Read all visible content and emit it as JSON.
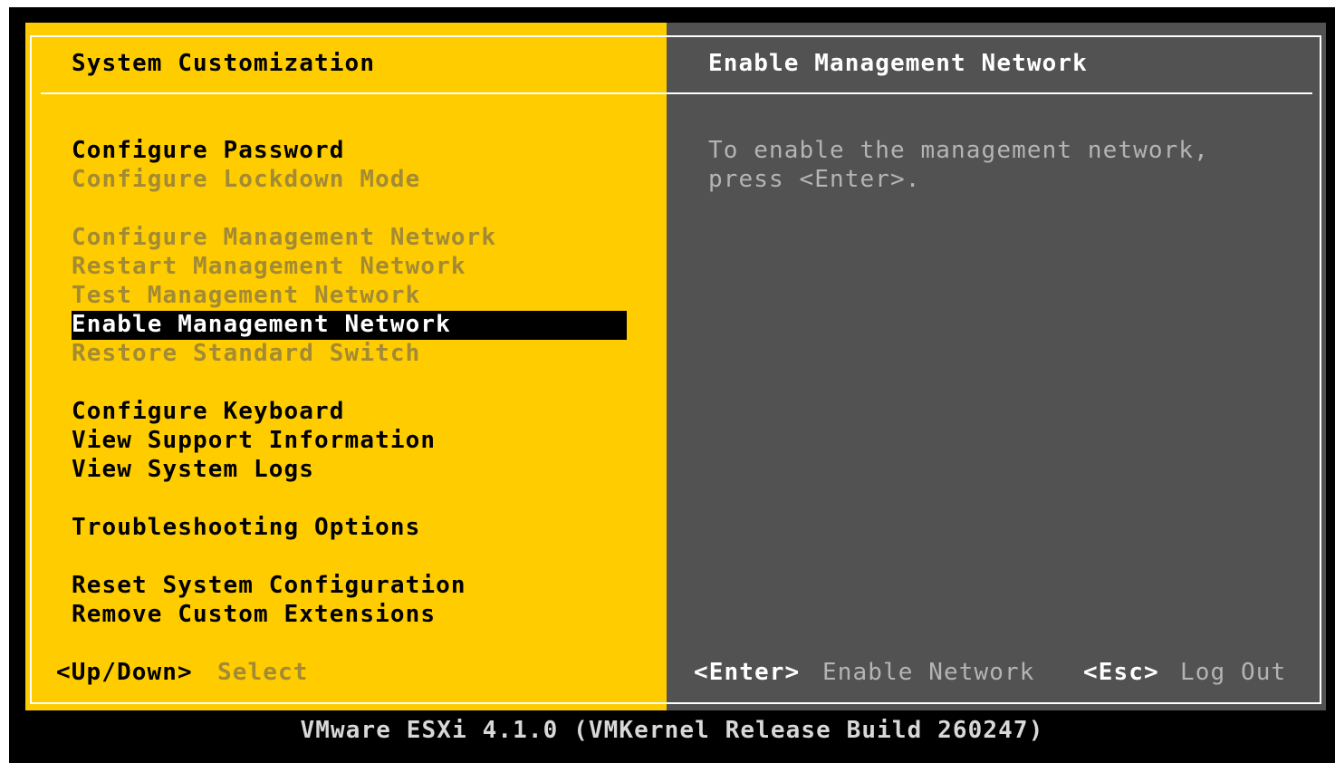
{
  "left_panel": {
    "title": "System Customization",
    "menu": [
      {
        "label": "Configure Password",
        "state": "enabled"
      },
      {
        "label": "Configure Lockdown Mode",
        "state": "disabled"
      },
      {
        "label": "Configure Management Network",
        "state": "disabled"
      },
      {
        "label": "Restart Management Network",
        "state": "disabled"
      },
      {
        "label": "Test Management Network",
        "state": "disabled"
      },
      {
        "label": "Enable Management Network",
        "state": "selected"
      },
      {
        "label": "Restore Standard Switch",
        "state": "disabled"
      },
      {
        "label": "Configure Keyboard",
        "state": "enabled"
      },
      {
        "label": "View Support Information",
        "state": "enabled"
      },
      {
        "label": "View System Logs",
        "state": "enabled"
      },
      {
        "label": "Troubleshooting Options",
        "state": "enabled"
      },
      {
        "label": "Reset System Configuration",
        "state": "enabled"
      },
      {
        "label": "Remove Custom Extensions",
        "state": "enabled"
      }
    ],
    "hint_key": "<Up/Down>",
    "hint_action": "Select"
  },
  "right_panel": {
    "title": "Enable Management Network",
    "description_line1": "To enable the management network,",
    "description_line2": "press <Enter>.",
    "enter_key": "<Enter>",
    "enter_action": "Enable Network",
    "esc_key": "<Esc>",
    "esc_action": "Log Out"
  },
  "footer": {
    "version": "VMware ESXi 4.1.0 (VMKernel Release Build 260247)"
  },
  "colors": {
    "left_background": "#ffcc00",
    "right_background": "#525252",
    "selection_background": "#000000",
    "disabled_text": "#a38a35",
    "screen_background": "#000000"
  }
}
